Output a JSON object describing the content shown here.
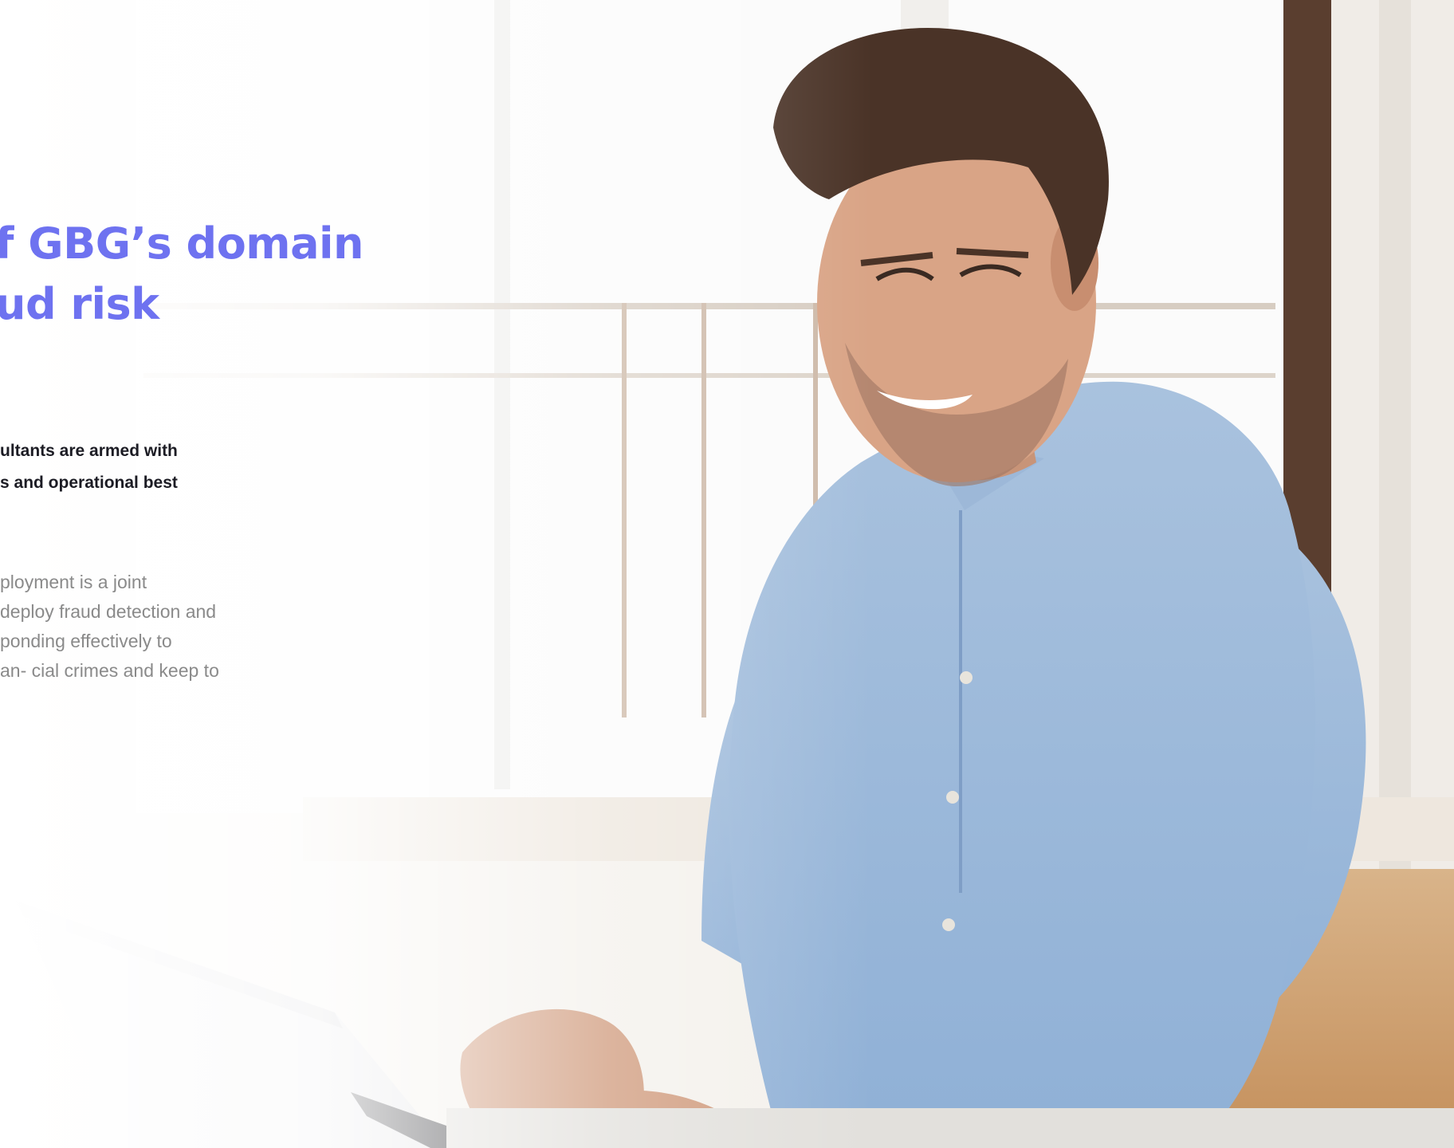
{
  "hero": {
    "heading_lines": [
      "f GBG’s domain",
      "ud risk"
    ],
    "subheading_lines": [
      "ultants are armed with",
      "s and operational best"
    ],
    "body_lines": [
      "ployment is a joint",
      " deploy fraud detection and",
      "ponding effectively to",
      "an- cial crimes and keep to"
    ],
    "accent_color": "#6e72f0"
  }
}
